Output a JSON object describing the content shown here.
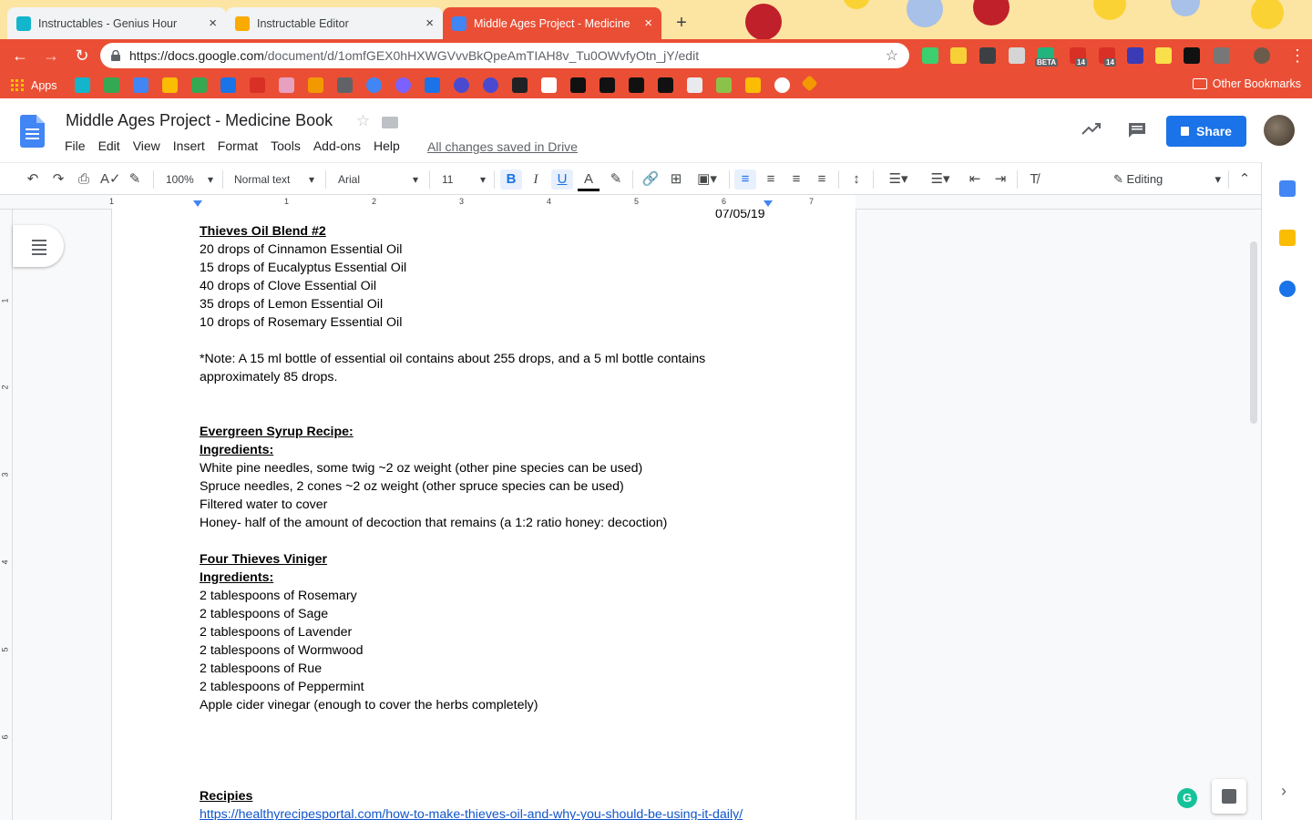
{
  "browser": {
    "tabs": [
      {
        "title": "Instructables - Genius Hour",
        "close": "×",
        "active": false,
        "favicon_color": "#12b5cb"
      },
      {
        "title": "Instructable Editor",
        "close": "×",
        "active": false,
        "favicon_color": "#f9ab00"
      },
      {
        "title": "Middle Ages Project - Medicine",
        "close": "×",
        "active": true,
        "favicon_color": "#4285f4"
      }
    ],
    "new_tab": "+",
    "url_domain": "https://docs.google.com",
    "url_path": "/document/d/1omfGEX0hHXWGVvvBkQpeAmTIAH8v_Tu0OWvfyOtn_jY/edit",
    "ext_badges": [
      "BETA",
      "14",
      "14"
    ],
    "bookmarks": {
      "apps_label": "Apps",
      "other_label": "Other Bookmarks"
    }
  },
  "docs": {
    "title": "Middle Ages Project - Medicine Book",
    "menu": [
      "File",
      "Edit",
      "View",
      "Insert",
      "Format",
      "Tools",
      "Add-ons",
      "Help"
    ],
    "save_status": "All changes saved in Drive",
    "share_label": "Share",
    "toolbar": {
      "zoom": "100%",
      "style": "Normal text",
      "font": "Arial",
      "size": "11",
      "mode": "Editing"
    },
    "ruler_numbers": [
      "1",
      "1",
      "2",
      "3",
      "4",
      "5",
      "6",
      "7"
    ],
    "vruler_numbers": [
      "1",
      "2",
      "3",
      "4",
      "5",
      "6"
    ]
  },
  "document": {
    "header_date": "07/05/19",
    "lines": [
      {
        "text": "Thieves Oil Blend #2",
        "style": "hdg"
      },
      {
        "text": "20 drops of Cinnamon Essential Oil",
        "style": ""
      },
      {
        "text": "15 drops of Eucalyptus Essential Oil",
        "style": ""
      },
      {
        "text": "40 drops of Clove Essential Oil",
        "style": ""
      },
      {
        "text": "35 drops of Lemon Essential Oil",
        "style": ""
      },
      {
        "text": "10 drops of Rosemary Essential Oil",
        "style": ""
      },
      {
        "text": "",
        "style": ""
      },
      {
        "text": "*Note: A 15 ml bottle of essential oil contains about 255 drops, and a 5 ml bottle contains",
        "style": ""
      },
      {
        "text": "approximately 85 drops.",
        "style": ""
      },
      {
        "text": "",
        "style": ""
      },
      {
        "text": "",
        "style": ""
      },
      {
        "text": "Evergreen Syrup Recipe:",
        "style": "hdg"
      },
      {
        "text": "Ingredients:",
        "style": "hdg"
      },
      {
        "text": "White pine needles, some twig ~2 oz weight (other pine species can be used)",
        "style": ""
      },
      {
        "text": "Spruce needles, 2 cones ~2 oz weight (other spruce species can be used)",
        "style": ""
      },
      {
        "text": "Filtered water to cover",
        "style": ""
      },
      {
        "text": "Honey- half of the amount of decoction that remains (a 1:2 ratio honey: decoction)",
        "style": ""
      },
      {
        "text": "",
        "style": ""
      },
      {
        "text": "Four Thieves Viniger",
        "style": "hdg"
      },
      {
        "text": "Ingredients:",
        "style": "hdg"
      },
      {
        "text": "2 tablespoons of Rosemary",
        "style": ""
      },
      {
        "text": "2 tablespoons of Sage",
        "style": ""
      },
      {
        "text": "2 tablespoons of Lavender",
        "style": ""
      },
      {
        "text": "2 tablespoons of Wormwood",
        "style": ""
      },
      {
        "text": "2 tablespoons of Rue",
        "style": ""
      },
      {
        "text": "2 tablespoons of Peppermint",
        "style": ""
      },
      {
        "text": "Apple cider vinegar (enough to cover the herbs completely)",
        "style": ""
      },
      {
        "text": "",
        "style": ""
      },
      {
        "text": "",
        "style": ""
      },
      {
        "text": "",
        "style": ""
      },
      {
        "text": "",
        "style": ""
      },
      {
        "text": "Recipies",
        "style": "hdg"
      },
      {
        "text": "https://healthyrecipesportal.com/how-to-make-thieves-oil-and-why-you-should-be-using-it-daily/",
        "style": "link"
      }
    ]
  },
  "colors": {
    "chrome_accent": "#ea4f35",
    "share_blue": "#1a73e8"
  }
}
